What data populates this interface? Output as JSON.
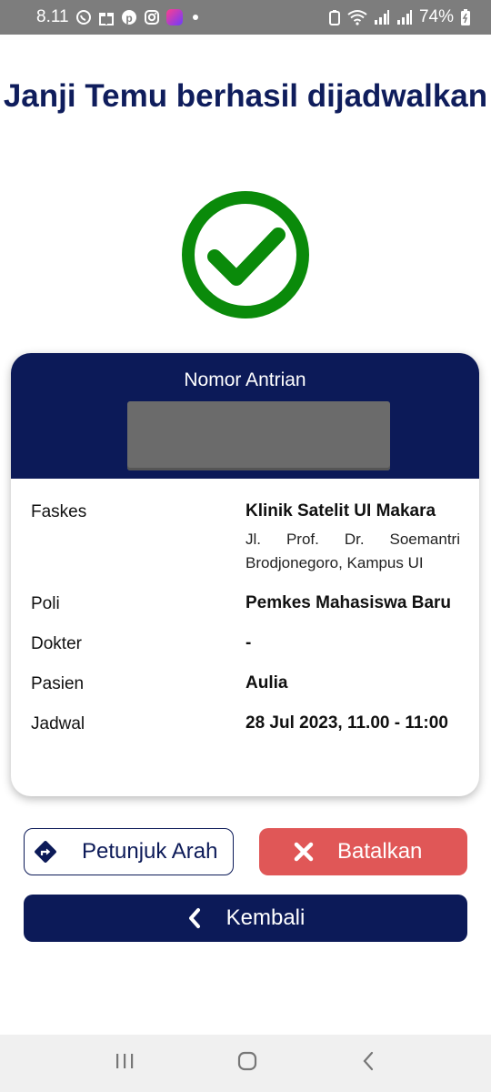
{
  "status_bar": {
    "time": "8.11",
    "battery": "74%"
  },
  "header": {
    "title": "Janji Temu berhasil dijadwalkan"
  },
  "ticket": {
    "queue_label": "Nomor Antrian",
    "rows": [
      {
        "label": "Faskes",
        "value": "Klinik Satelit UI Makara",
        "address": "Jl. Prof. Dr. Soemantri Brodjonegoro, Kampus UI"
      },
      {
        "label": "Poli",
        "value": "Pemkes Mahasiswa Baru"
      },
      {
        "label": "Dokter",
        "value": "-"
      },
      {
        "label": "Pasien",
        "value": "Aulia"
      },
      {
        "label": "Jadwal",
        "value": "28 Jul 2023, 11.00 - 11:00"
      }
    ]
  },
  "actions": {
    "directions_label": "Petunjuk Arah",
    "cancel_label": "Batalkan",
    "back_label": "Kembali"
  },
  "colors": {
    "navy": "#0c1a58",
    "title_navy": "#0f1d5c",
    "success_green": "#0a8a0a",
    "cancel_red": "#e05757"
  }
}
